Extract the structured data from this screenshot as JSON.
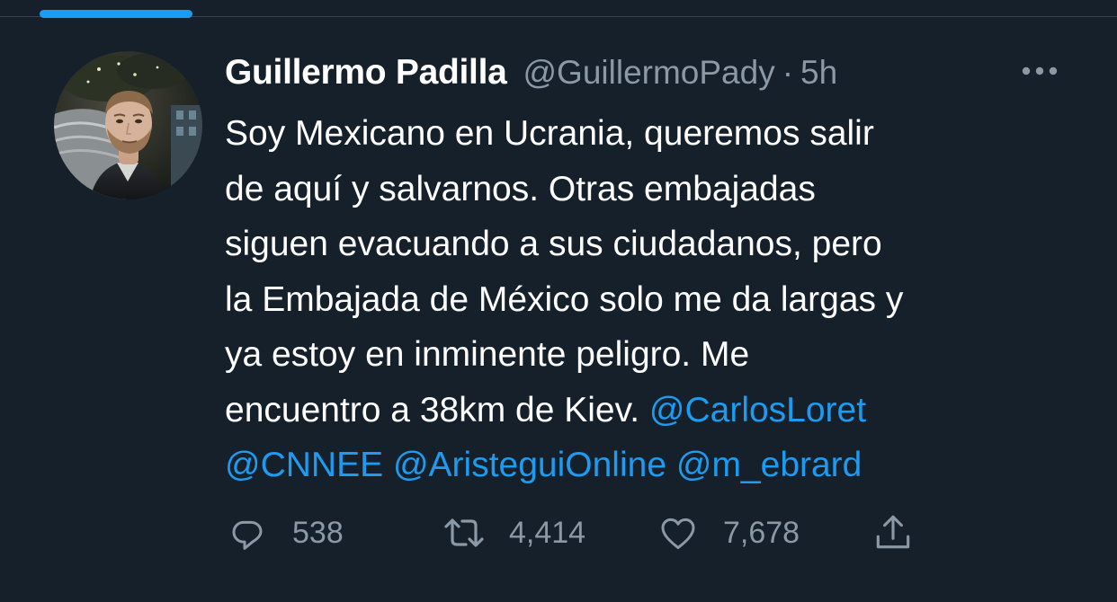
{
  "tweet": {
    "author": {
      "display_name": "Guillermo Padilla",
      "handle": "@GuillermoPady"
    },
    "separator": "·",
    "time": "5h",
    "text_lines": [
      [
        {
          "text": "Soy Mexicano en Ucrania, queremos salir"
        }
      ],
      [
        {
          "text": "de aquí y salvarnos. Otras embajadas"
        }
      ],
      [
        {
          "text": "siguen evacuando a sus ciudadanos, pero"
        }
      ],
      [
        {
          "text": "la Embajada de México solo me da largas y"
        }
      ],
      [
        {
          "text": "ya estoy en inminente peligro. Me"
        }
      ],
      [
        {
          "text": "encuentro a 38km de Kiev. "
        },
        {
          "mention": "@CarlosLoret"
        }
      ],
      [
        {
          "mention": "@CNNEE"
        },
        {
          "text": " "
        },
        {
          "mention": "@AristeguiOnline"
        },
        {
          "text": " "
        },
        {
          "mention": "@m_ebrard"
        }
      ]
    ],
    "metrics": {
      "replies": "538",
      "retweets": "4,414",
      "likes": "7,678"
    }
  },
  "icons": {
    "more": "more-horizontal-icon",
    "reply": "reply-icon",
    "retweet": "retweet-icon",
    "like": "heart-icon",
    "share": "share-icon"
  },
  "colors": {
    "background": "#15202b",
    "text": "#ffffff",
    "secondary": "#8b98a5",
    "accent": "#1d9bf0"
  }
}
